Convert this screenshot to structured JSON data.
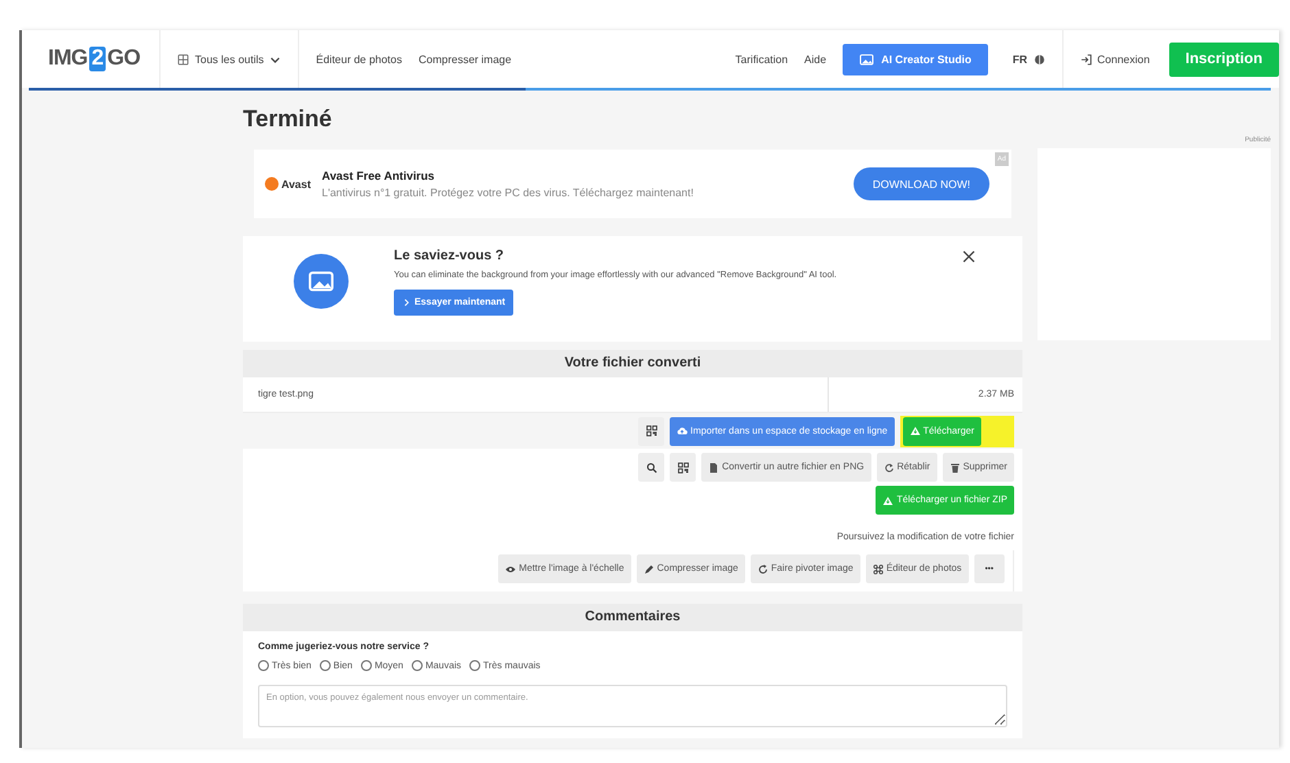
{
  "header": {
    "logo": [
      "IMG",
      "2",
      "GO"
    ],
    "tools_menu": "Tous les outils",
    "nav": [
      "Éditeur de photos",
      "Compresser image"
    ],
    "right_nav": [
      "Tarification",
      "Aide"
    ],
    "studio_button": "AI Creator Studio",
    "language": "FR",
    "login": "Connexion",
    "signup": "Inscription"
  },
  "page_title": "Terminé",
  "ad": {
    "brand": "Avast",
    "title": "Avast Free Antivirus",
    "text": "L'antivirus n°1 gratuit. Protégez votre PC des virus. Téléchargez maintenant!",
    "button": "DOWNLOAD NOW!",
    "badge": "Ad"
  },
  "side_ad": {
    "label": "Publicité"
  },
  "tip": {
    "title": "Le saviez-vous ?",
    "text": "You can eliminate the background from your image effortlessly with our advanced \"Remove Background\" AI tool.",
    "button": "Essayer maintenant"
  },
  "converted": {
    "heading": "Votre fichier converti",
    "file_name": "tigre test.png",
    "file_size": "2.37 MB",
    "primary_actions": [
      {
        "kind": "qr"
      },
      {
        "kind": "primary",
        "label": "Importer dans un espace de stockage en ligne",
        "highlighted": false
      },
      {
        "kind": "success",
        "label": "Télécharger",
        "highlighted": true
      }
    ],
    "secondary_actions": [
      {
        "kind": "search"
      },
      {
        "kind": "qr"
      },
      {
        "kind": "default",
        "label": "Convertir un autre fichier en PNG"
      },
      {
        "kind": "default",
        "label": "Rétablir"
      },
      {
        "kind": "default",
        "label": "Supprimer"
      }
    ],
    "zip_button": "Télécharger un fichier ZIP",
    "continue_text": "Poursuivez la modification de votre fichier",
    "tools": [
      {
        "kind": "default",
        "label": "Mettre l'image à l'échelle"
      },
      {
        "kind": "default",
        "label": "Compresser image"
      },
      {
        "kind": "default",
        "label": "Faire pivoter image"
      },
      {
        "kind": "default",
        "label": "Éditeur de photos"
      },
      {
        "kind": "more",
        "label": "•••"
      }
    ]
  },
  "feedback": {
    "heading": "Commentaires",
    "question": "Comme jugeriez-vous notre service ?",
    "ratings": [
      {
        "label": "Très bien",
        "selected": false
      },
      {
        "label": "Bien",
        "selected": false
      },
      {
        "label": "Moyen",
        "selected": false
      },
      {
        "label": "Mauvais",
        "selected": false
      },
      {
        "label": "Très mauvais",
        "selected": false
      }
    ],
    "comment_placeholder": "En option, vous pouvez également nous envoyer un commentaire."
  }
}
